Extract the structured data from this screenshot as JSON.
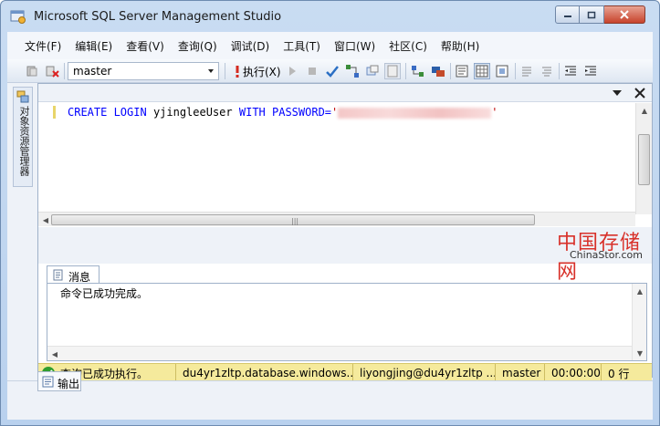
{
  "window": {
    "title": "Microsoft SQL Server Management Studio"
  },
  "menu": {
    "items": [
      "文件(F)",
      "编辑(E)",
      "查看(V)",
      "查询(Q)",
      "调试(D)",
      "工具(T)",
      "窗口(W)",
      "社区(C)",
      "帮助(H)"
    ]
  },
  "toolbar": {
    "database": "master",
    "execute_label": "执行(X)"
  },
  "object_explorer": {
    "label": "对象资源管理器"
  },
  "editor": {
    "kw_create_login": "CREATE LOGIN",
    "login_name": "yjingleeUser",
    "kw_with_password": "WITH PASSWORD=",
    "quote_open": "'",
    "quote_close": "'"
  },
  "watermark": {
    "cn": "中国存储网",
    "en": "ChinaStor.com"
  },
  "results": {
    "tab_label": "消息",
    "message": "命令已成功完成。"
  },
  "status": {
    "query_status": "查询已成功执行。",
    "server": "du4yr1zltp.database.windows...",
    "user": "liyongjing@du4yr1zltp ...",
    "database": "master",
    "elapsed": "00:00:00",
    "rows": "0 行"
  },
  "output": {
    "tab_label": "输出"
  },
  "colors": {
    "keyword": "#0000ff",
    "string": "#c00000",
    "status_bar": "#f5ea9c",
    "success": "#2f9e2f"
  }
}
